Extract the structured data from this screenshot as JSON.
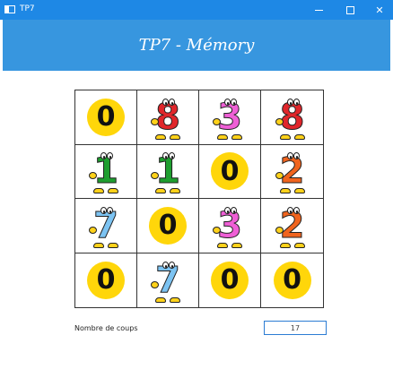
{
  "window": {
    "title": "TP7"
  },
  "header": {
    "title": "TP7 - Mémory"
  },
  "board": {
    "cards": [
      {
        "state": "hidden",
        "label": "0"
      },
      {
        "state": "revealed",
        "label": "8",
        "color": "#e0262b"
      },
      {
        "state": "revealed",
        "label": "3",
        "color": "#ef5fd6"
      },
      {
        "state": "revealed",
        "label": "8",
        "color": "#e0262b"
      },
      {
        "state": "revealed",
        "label": "1",
        "color": "#1e9e2f"
      },
      {
        "state": "revealed",
        "label": "1",
        "color": "#1e9e2f"
      },
      {
        "state": "hidden",
        "label": "0"
      },
      {
        "state": "revealed",
        "label": "2",
        "color": "#f0641e"
      },
      {
        "state": "revealed",
        "label": "7",
        "color": "#7cc3f2"
      },
      {
        "state": "hidden",
        "label": "0"
      },
      {
        "state": "revealed",
        "label": "3",
        "color": "#ef5fd6"
      },
      {
        "state": "revealed",
        "label": "2",
        "color": "#f0641e"
      },
      {
        "state": "hidden",
        "label": "0"
      },
      {
        "state": "revealed",
        "label": "7",
        "color": "#7cc3f2"
      },
      {
        "state": "hidden",
        "label": "0"
      },
      {
        "state": "hidden",
        "label": "0"
      }
    ]
  },
  "counter": {
    "label": "Nombre de coups",
    "value": "17"
  }
}
